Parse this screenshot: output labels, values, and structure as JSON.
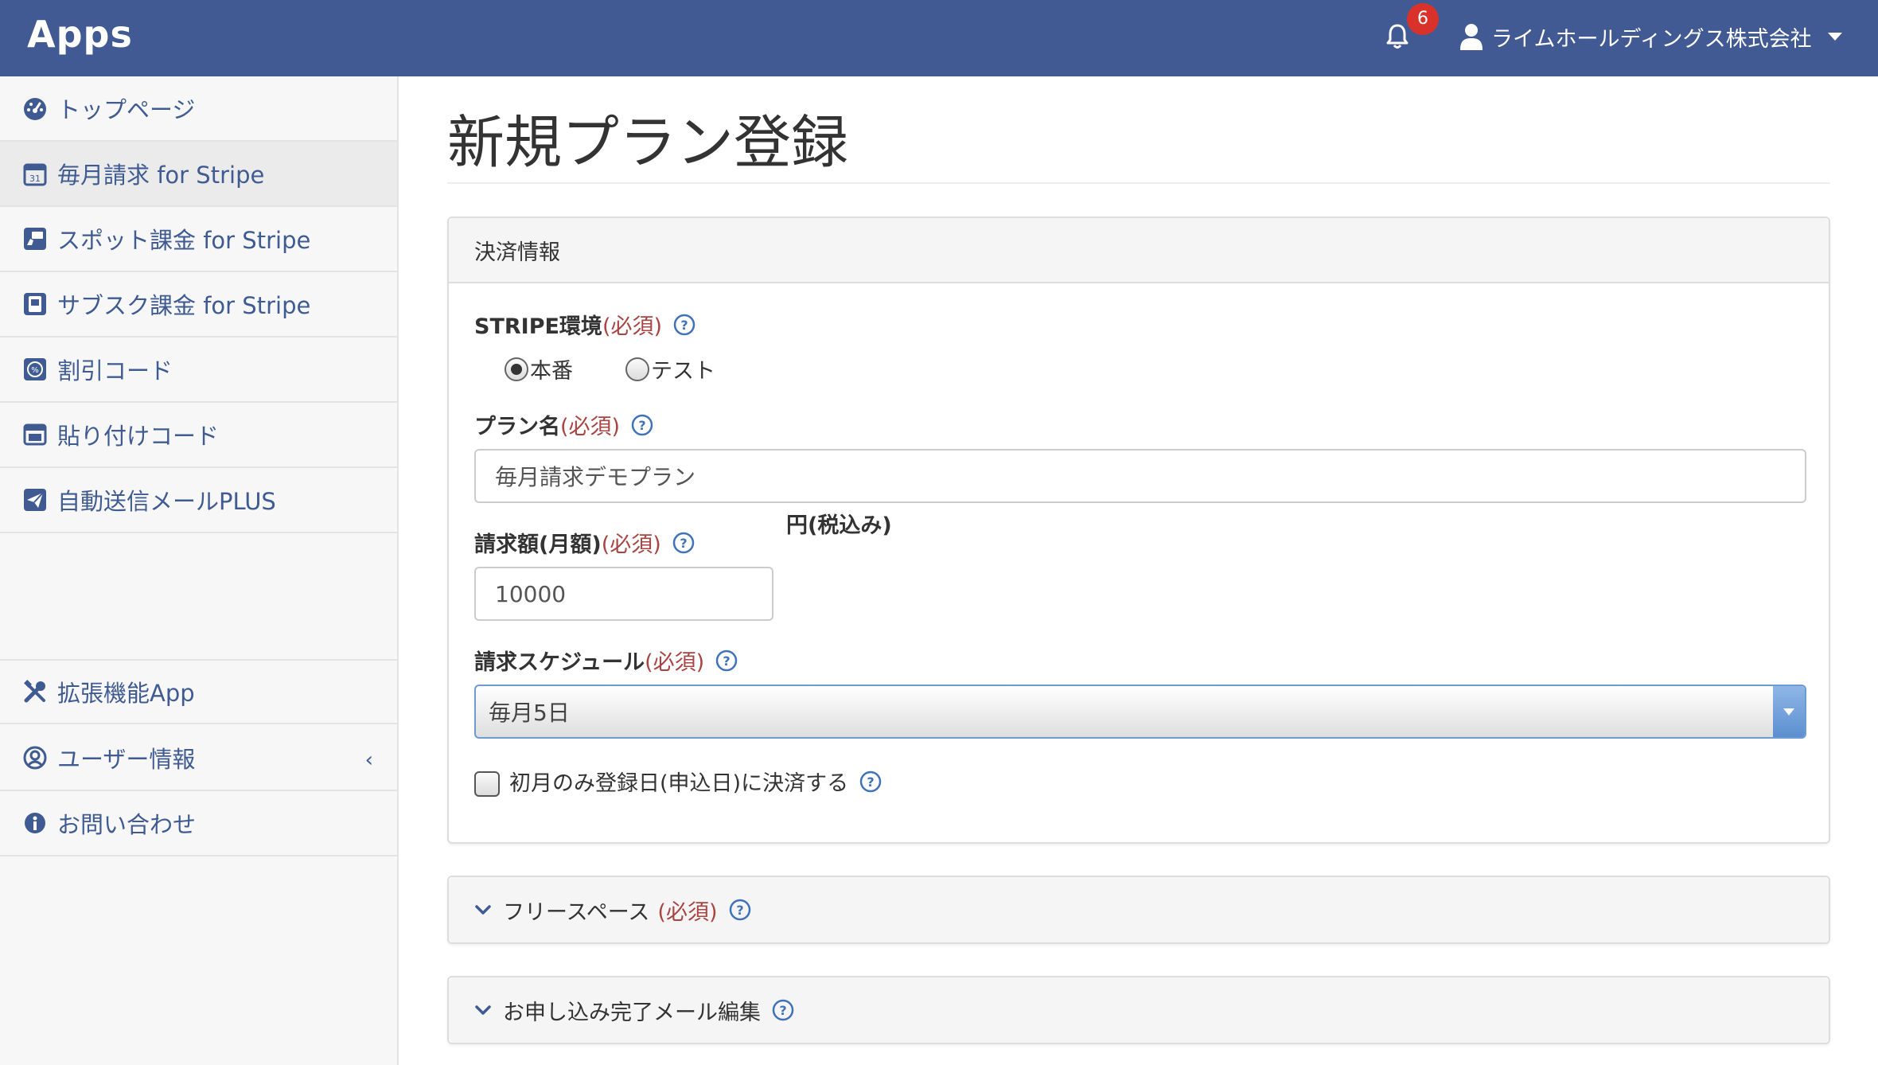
{
  "header": {
    "brand": "Apps",
    "notification_count": "6",
    "company_name": "ライムホールディングス株式会社"
  },
  "sidebar": {
    "items": [
      {
        "label": "トップページ",
        "icon": "dashboard-icon"
      },
      {
        "label": "毎月請求 for Stripe",
        "icon": "calendar-icon"
      },
      {
        "label": "スポット課金 for Stripe",
        "icon": "hand-card-icon"
      },
      {
        "label": "サブスク課金 for Stripe",
        "icon": "subscription-icon"
      },
      {
        "label": "割引コード",
        "icon": "discount-icon"
      },
      {
        "label": "貼り付けコード",
        "icon": "embed-code-icon"
      },
      {
        "label": "自動送信メールPLUS",
        "icon": "send-mail-icon"
      }
    ],
    "bottom_items": [
      {
        "label": "拡張機能App",
        "icon": "tools-icon"
      },
      {
        "label": "ユーザー情報",
        "icon": "user-circle-icon"
      },
      {
        "label": "お問い合わせ",
        "icon": "info-icon"
      }
    ]
  },
  "page": {
    "title": "新規プラン登録"
  },
  "payment_panel": {
    "heading": "決済情報",
    "stripe_env": {
      "label": "STRIPE環境",
      "required": "(必須)",
      "options": [
        "本番",
        "テスト"
      ],
      "selected": "本番"
    },
    "plan_name": {
      "label": "プラン名",
      "required": "(必須)",
      "value": "毎月請求デモプラン"
    },
    "amount": {
      "label": "請求額(月額)",
      "required": "(必須)",
      "value": "10000",
      "suffix": "円(税込み)"
    },
    "schedule": {
      "label": "請求スケジュール",
      "required": "(必須)",
      "selected": "毎月5日"
    },
    "first_month": {
      "label": "初月のみ登録日(申込日)に決済する",
      "checked": false
    }
  },
  "collapsed_panels": [
    {
      "label": "フリースペース",
      "required": "(必須)"
    },
    {
      "label": "お申し込み完了メール編集",
      "required": ""
    }
  ],
  "colors": {
    "header_bg": "#425a93",
    "link": "#3f5b92",
    "required": "#a94442",
    "badge": "#d9322b"
  }
}
